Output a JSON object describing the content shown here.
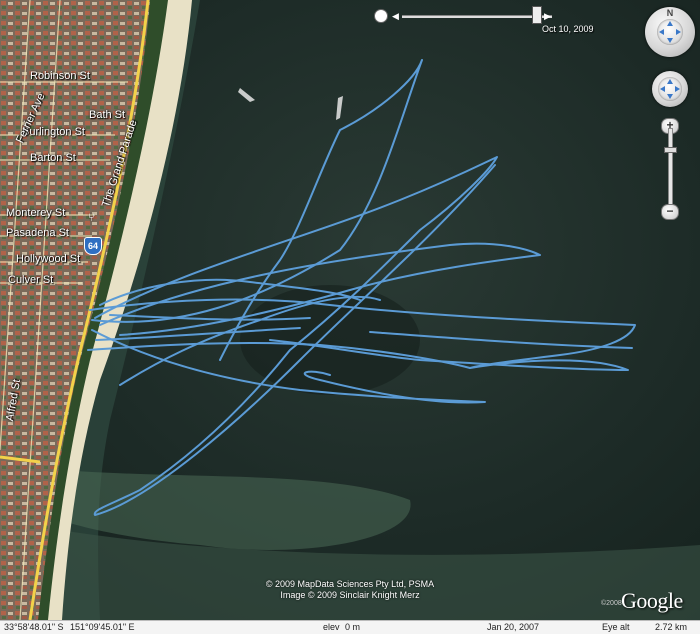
{
  "streets": {
    "robinson": "Robinson St",
    "bath": "Bath St",
    "burlington": "Burlington St",
    "barton": "Barton St",
    "monterey": "Monterey St",
    "pasadena": "Pasadena St",
    "hollywood": "Hollywood St",
    "culver": "Culver St",
    "alfred": "Alfred St",
    "ferrier": "Ferrier Ave",
    "grand_parade": "The Grand Parade",
    "route_shield": "64"
  },
  "time_slider": {
    "date": "Oct 10, 2009"
  },
  "attribution": {
    "line1": "© 2009 MapData Sciences Pty Ltd, PSMA",
    "line2": "Image © 2009 Sinclair Knight Merz"
  },
  "logo": {
    "text": "Google",
    "year": "©2008"
  },
  "nav": {
    "north_label": "N",
    "zoom_in": "+",
    "zoom_out": "−",
    "zoom_level": 0.78
  },
  "status": {
    "lat": "33°58'48.01\" S",
    "lon": "151°09'45.01\" E",
    "elev_label": "elev",
    "elev_value": "0 m",
    "imagery_date": "Jan 20, 2007",
    "eye_alt_label": "Eye alt",
    "eye_alt_value": "2.72 km"
  },
  "colors": {
    "track": "#5b9bd5",
    "water_deep": "#1c2a28",
    "water_shallow": "#3b5a4a",
    "sand": "#e8e1c6",
    "road": "#f2d24a"
  }
}
